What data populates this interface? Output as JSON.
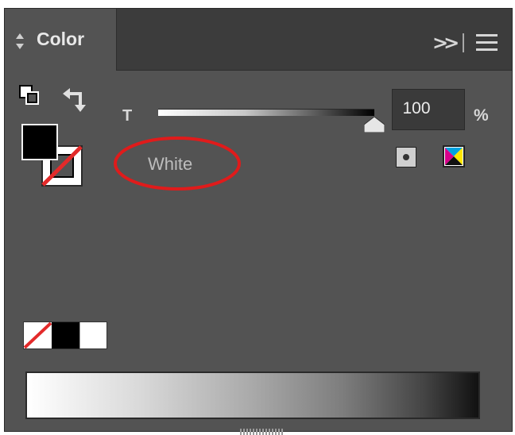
{
  "panel": {
    "tab_title": "Color",
    "collapse_label": ">>",
    "tint_label": "T",
    "tint_percent": 100,
    "tint_value_text": "100",
    "percent_sign": "%",
    "color_name": "White"
  },
  "colors": {
    "panel_bg": "#535353",
    "tabbar_bg": "#3c3c3c",
    "fill_color": "#000000",
    "stroke_none_slash": "#e32a2a",
    "highlight_ellipse": "#e01b1b",
    "input_bg": "#3a3a3a"
  },
  "icons": {
    "tab_arrows": "updown-arrows-icon",
    "collapse": "double-chevron-right-icon",
    "menu": "hamburger-icon",
    "default_colors": "default-fill-stroke-icon",
    "swap": "swap-fill-stroke-icon",
    "process_color": "process-color-icon",
    "cmyk": "cmyk-icon"
  },
  "swatches": [
    "none",
    "black",
    "white"
  ]
}
